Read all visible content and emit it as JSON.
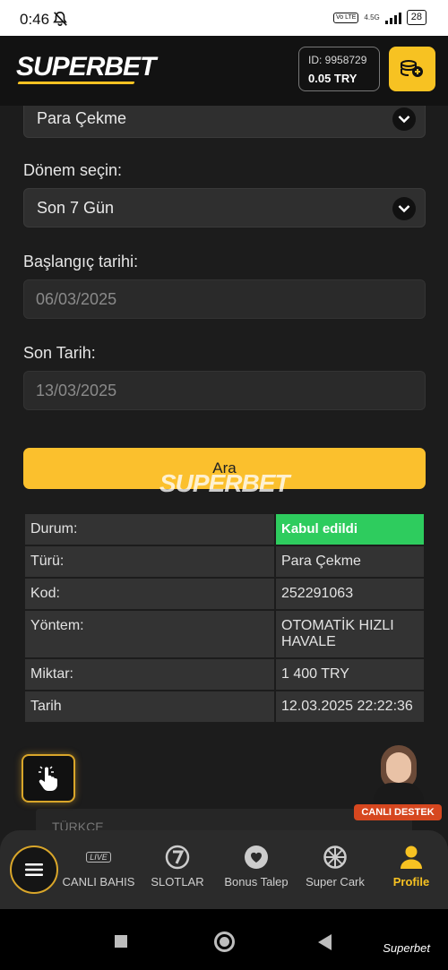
{
  "status_bar": {
    "time": "0:46",
    "volte": "Vo LTE",
    "network": "4.5G",
    "battery": "28"
  },
  "header": {
    "logo": "SUPERBET",
    "account_id": "ID: 9958729",
    "balance": "0.05 TRY"
  },
  "form": {
    "type_value": "Para Çekme",
    "period_label": "Dönem seçin:",
    "period_value": "Son 7 Gün",
    "start_label": "Başlangıç tarihi:",
    "start_value": "06/03/2025",
    "end_label": "Son Tarih:",
    "end_value": "13/03/2025",
    "search_button": "Ara"
  },
  "watermark": "SUPERBET",
  "result": {
    "rows": [
      {
        "key": "Durum:",
        "value": "Kabul edildi"
      },
      {
        "key": "Türü:",
        "value": "Para Çekme"
      },
      {
        "key": "Kod:",
        "value": "252291063"
      },
      {
        "key": "Yöntem:",
        "value": "OTOMATİK HIZLI HAVALE"
      },
      {
        "key": "Miktar:",
        "value": "1 400 TRY"
      },
      {
        "key": "Tarih",
        "value": "12.03.2025 22:22:36"
      }
    ],
    "status_color": "#2ecc5e"
  },
  "support": {
    "label": "CANLI DESTEK"
  },
  "language": {
    "value": "TÜRKÇE"
  },
  "bottom_nav": {
    "items": [
      {
        "label": "CANLI BAHIS",
        "icon": "live-icon",
        "badge": "LIVE"
      },
      {
        "label": "SLOTLAR",
        "icon": "slot-seven-icon"
      },
      {
        "label": "Bonus Talep",
        "icon": "heart-icon"
      },
      {
        "label": "Super Cark",
        "icon": "wheel-icon"
      },
      {
        "label": "Profile",
        "icon": "user-icon"
      }
    ]
  },
  "system_nav": {
    "app_name": "Superbet"
  },
  "colors": {
    "accent": "#f7c222",
    "background": "#1c1c1c",
    "success": "#2ecc5e"
  }
}
